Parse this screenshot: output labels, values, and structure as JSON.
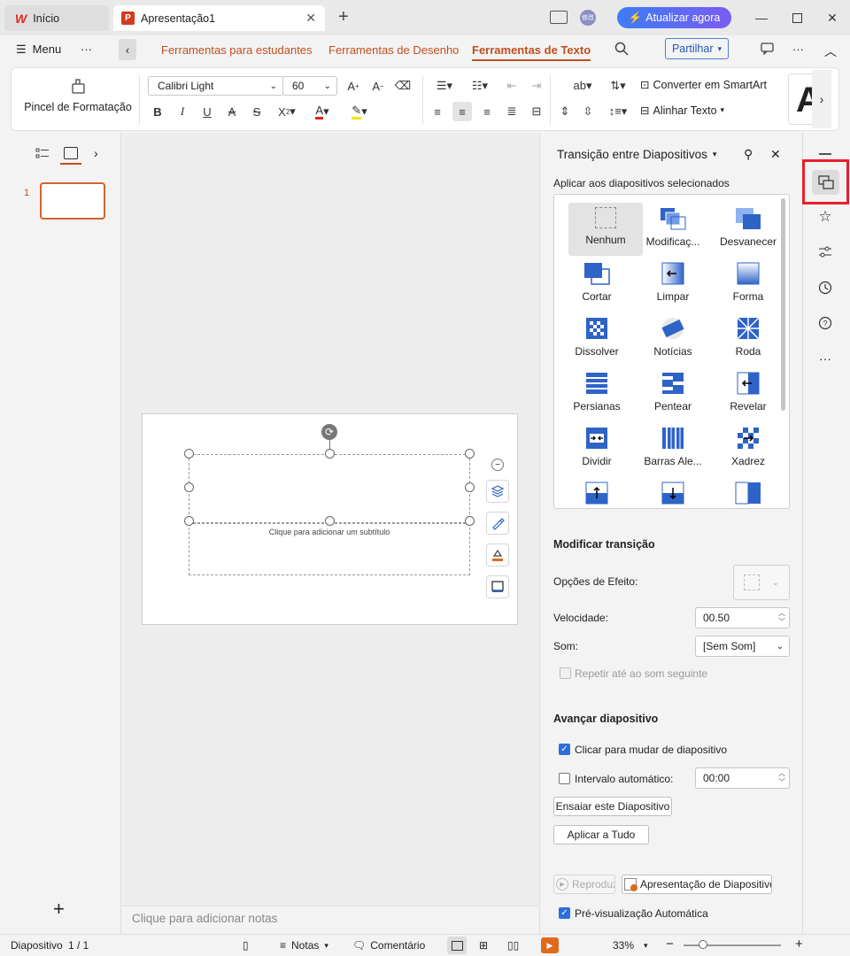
{
  "titlebar": {
    "home_tab": "Início",
    "doc_tab": "Apresentação1",
    "update_button": "Atualizar agora"
  },
  "menubar": {
    "menu": "Menu",
    "more": "···",
    "tabs": [
      "Ferramentas para estudantes",
      "Ferramentas de Desenho",
      "Ferramentas de Texto"
    ],
    "active_tab": "Ferramentas de Texto",
    "share": "Partilhar"
  },
  "ribbon": {
    "format_painter": "Pincel de Formatação",
    "font_name": "Calibri Light",
    "font_size": "60",
    "convert_smartart": "Converter em SmartArt",
    "align_text": "Alinhar Texto"
  },
  "thumbnails": {
    "slide_number": "1"
  },
  "slide": {
    "subtitle_placeholder": "Clique para adicionar um subtítulo"
  },
  "notes": {
    "placeholder": "Clique para adicionar notas"
  },
  "pane": {
    "title": "Transição entre Diapositivos",
    "apply_label": "Aplicar aos diapositivos selecionados",
    "transitions": [
      "Nenhum",
      "Modificaç...",
      "Desvanecer",
      "Cortar",
      "Limpar",
      "Forma",
      "Dissolver",
      "Notícias",
      "Roda",
      "Persianas",
      "Pentear",
      "Revelar",
      "Dividir",
      "Barras Ale...",
      "Xadrez"
    ],
    "selected_transition": "Nenhum",
    "modify_heading": "Modificar transição",
    "effect_options": "Opções de Efeito:",
    "speed_label": "Velocidade:",
    "speed_value": "00.50",
    "sound_label": "Som:",
    "sound_value": "[Sem Som]",
    "loop_label": "Repetir até ao som seguinte",
    "advance_heading": "Avançar diapositivo",
    "on_click_label": "Clicar para mudar de diapositivo",
    "on_click_checked": true,
    "auto_label": "Intervalo automático:",
    "auto_checked": false,
    "auto_value": "00:00",
    "rehearse_button": "Ensaiar este Diapositivo",
    "apply_all_button": "Aplicar a Tudo",
    "play_button": "Reproduz",
    "slideshow_button": "Apresentação de Diapositivo",
    "autopreview_label": "Pré-visualização Automática",
    "autopreview_checked": true
  },
  "status": {
    "slide_label": "Diapositivo",
    "slide_counter": "1 / 1",
    "notes": "Notas",
    "comment": "Comentário",
    "zoom": "33%"
  },
  "colors": {
    "accent": "#c0501f",
    "selected_border": "#d4622d",
    "checkbox": "#2c6fdb",
    "highlight_box": "#e8202a"
  }
}
